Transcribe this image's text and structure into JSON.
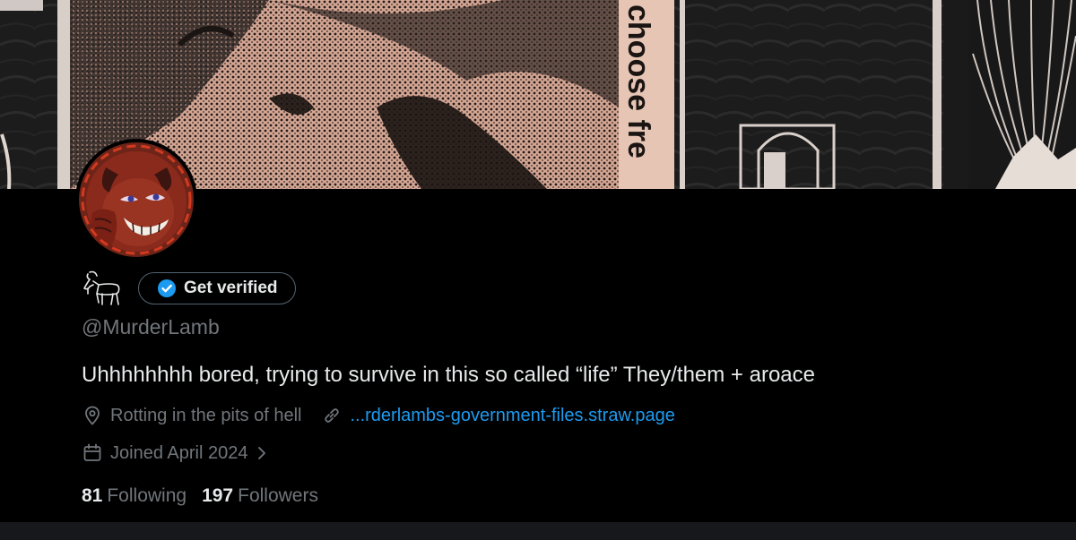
{
  "banner": {
    "text": "choose fre"
  },
  "profile": {
    "verify_label": "Get verified",
    "handle": "@MurderLamb",
    "bio": "Uhhhhhhhh bored, trying to survive in this so called “life” They/them + aroace",
    "location": "Rotting in the pits of hell",
    "website": "...rderlambs-government-files.straw.page",
    "joined": "Joined April 2024",
    "following_count": "81",
    "following_label": "Following",
    "followers_count": "197",
    "followers_label": "Followers"
  },
  "icons": {
    "location": "location-pin-icon",
    "link": "link-icon",
    "calendar": "calendar-icon",
    "chevron": "chevron-right-icon",
    "badge": "verified-badge-icon",
    "display_name": "goat-emoji-icon"
  },
  "colors": {
    "background": "#000000",
    "text_primary": "#e7e9ea",
    "text_secondary": "#71767b",
    "link": "#1d9bf0",
    "button_border": "#536471",
    "banner_pink": "#d6a898",
    "avatar_red": "#8a2418"
  }
}
